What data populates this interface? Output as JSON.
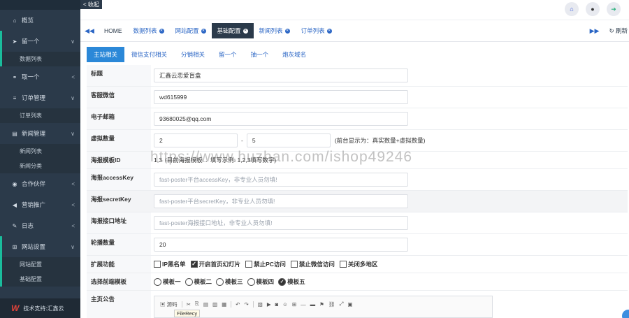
{
  "topbar": {
    "collapse_label": "< 收起",
    "icons": [
      "home-icon",
      "user-icon",
      "logout-icon"
    ]
  },
  "sidebar": {
    "items": [
      {
        "label": "概览",
        "icon": "home-icon",
        "arrow": ""
      },
      {
        "label": "留一个",
        "icon": "send-icon",
        "arrow": "∨",
        "children": [
          "数据列表"
        ]
      },
      {
        "label": "取一个",
        "icon": "link-icon",
        "arrow": "<"
      },
      {
        "label": "订单管理",
        "icon": "list-icon",
        "arrow": "∨",
        "children": [
          "订单列表"
        ]
      },
      {
        "label": "新闻管理",
        "icon": "newspaper-icon",
        "arrow": "∨",
        "children": [
          "新闻列表",
          "新闻分类"
        ]
      },
      {
        "label": "合作伙伴",
        "icon": "eye-icon",
        "arrow": "<"
      },
      {
        "label": "营销推广",
        "icon": "bullhorn-icon",
        "arrow": "<"
      },
      {
        "label": "日志",
        "icon": "edit-icon",
        "arrow": "<"
      },
      {
        "label": "网站设置",
        "icon": "sitemap-icon",
        "arrow": "∨",
        "children": [
          "网站配置",
          "基础配置"
        ]
      }
    ],
    "footer": "技术支持:汇鑫云"
  },
  "tabs": {
    "items": [
      {
        "label": "HOME",
        "closable": false,
        "active": false
      },
      {
        "label": "数据列表",
        "closable": true,
        "active": false
      },
      {
        "label": "网站配置",
        "closable": true,
        "active": false
      },
      {
        "label": "基础配置",
        "closable": true,
        "active": true
      },
      {
        "label": "新闻列表",
        "closable": true,
        "active": false
      },
      {
        "label": "订单列表",
        "closable": true,
        "active": false
      }
    ],
    "refresh_label": "刷新"
  },
  "subtabs": [
    "主站相关",
    "微信支付相关",
    "分销相关",
    "留一个",
    "抽一个",
    "炮灰域名"
  ],
  "form": {
    "title": {
      "label": "标题",
      "value": "汇鑫云恋爱盲盒"
    },
    "wechat": {
      "label": "客服微信",
      "value": "wd615999"
    },
    "email": {
      "label": "电子邮箱",
      "value": "93680025@qq.com"
    },
    "virtual": {
      "label": "虚拟数量",
      "min": "2",
      "max": "5",
      "hint": "(前台显示为：真实数量+虚拟数量)"
    },
    "poster_template": {
      "label": "海报模板ID",
      "options": [
        "1,3",
        "(目前海报模板...",
        "填写示例: 1,2,3填写数字)"
      ]
    },
    "access_key": {
      "label": "海报accessKey",
      "placeholder": "fast-poster平台accessKey，非专业人员勿填!"
    },
    "secret_key": {
      "label": "海报secretKey",
      "placeholder": "fast-poster平台secretKey，非专业人员勿填!"
    },
    "poster_api": {
      "label": "海报接口地址",
      "placeholder": "fast-poster海报接口地址，非专业人员勿填!"
    },
    "carousel": {
      "label": "轮播数量",
      "value": "20"
    },
    "extensions": {
      "label": "扩展功能",
      "options": [
        {
          "label": "IP黑名单",
          "checked": false
        },
        {
          "label": "开启首页幻灯片",
          "checked": true
        },
        {
          "label": "禁止PC访问",
          "checked": false
        },
        {
          "label": "禁止微信访问",
          "checked": false
        },
        {
          "label": "关闭多地区",
          "checked": false
        }
      ]
    },
    "frontend_template": {
      "label": "选择前端模板",
      "options": [
        {
          "label": "模板一",
          "checked": false
        },
        {
          "label": "模板二",
          "checked": false
        },
        {
          "label": "模板三",
          "checked": false
        },
        {
          "label": "模板四",
          "checked": false
        },
        {
          "label": "模板五",
          "checked": true
        }
      ]
    },
    "announcement": {
      "label": "主页公告",
      "source_label": "源码",
      "tooltip": "FileRecy"
    }
  },
  "watermark": "https://www.huzhan.com/ishop49246"
}
